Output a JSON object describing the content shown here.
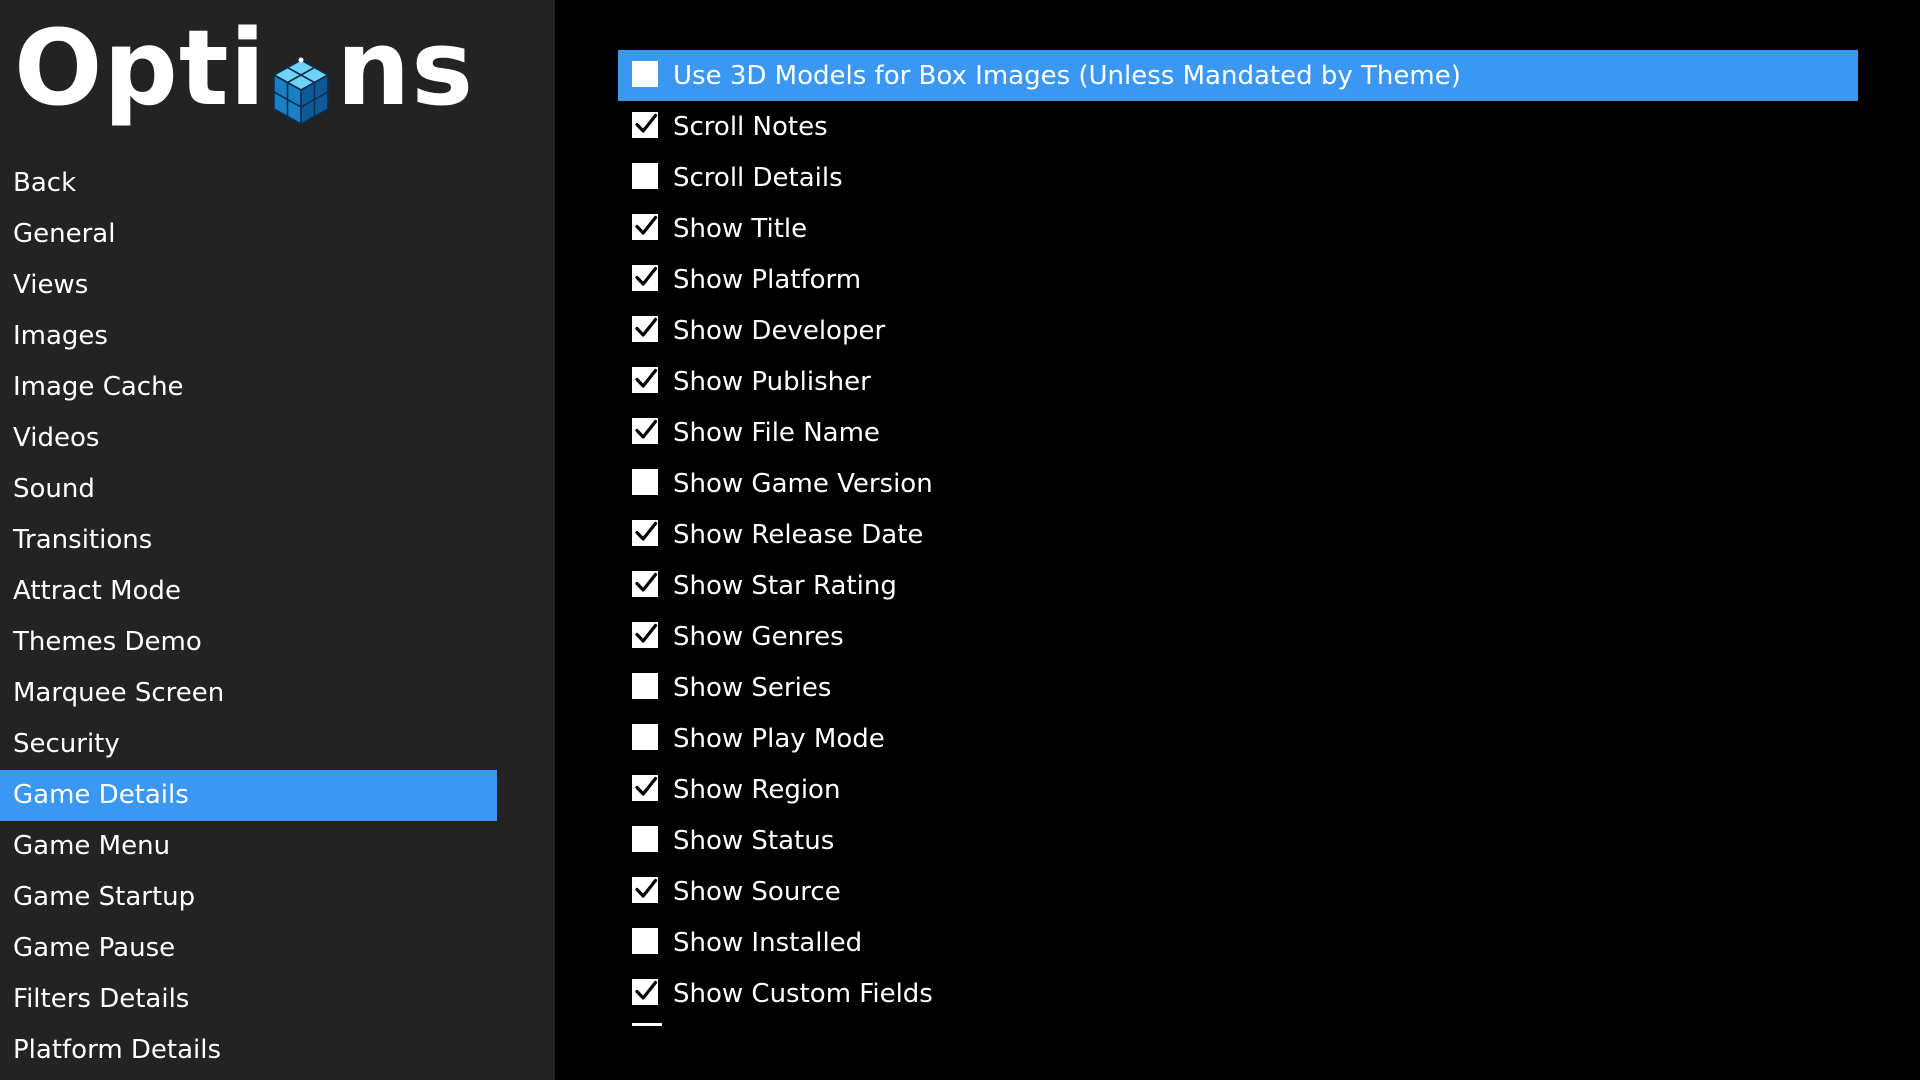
{
  "logo": {
    "text_before": "Opti",
    "text_after": "ns",
    "icon": "cube-icon"
  },
  "menu": {
    "items": [
      {
        "label": "Back",
        "selected": false
      },
      {
        "label": "General",
        "selected": false
      },
      {
        "label": "Views",
        "selected": false
      },
      {
        "label": "Images",
        "selected": false
      },
      {
        "label": "Image Cache",
        "selected": false
      },
      {
        "label": "Videos",
        "selected": false
      },
      {
        "label": "Sound",
        "selected": false
      },
      {
        "label": "Transitions",
        "selected": false
      },
      {
        "label": "Attract Mode",
        "selected": false
      },
      {
        "label": "Themes Demo",
        "selected": false
      },
      {
        "label": "Marquee Screen",
        "selected": false
      },
      {
        "label": "Security",
        "selected": false
      },
      {
        "label": "Game Details",
        "selected": true
      },
      {
        "label": "Game Menu",
        "selected": false
      },
      {
        "label": "Game Startup",
        "selected": false
      },
      {
        "label": "Game Pause",
        "selected": false
      },
      {
        "label": "Filters Details",
        "selected": false
      },
      {
        "label": "Platform Details",
        "selected": false
      }
    ]
  },
  "options": {
    "items": [
      {
        "label": "Use 3D Models for Box Images (Unless Mandated by Theme)",
        "checked": false,
        "selected": true
      },
      {
        "label": "Scroll Notes",
        "checked": true,
        "selected": false
      },
      {
        "label": "Scroll Details",
        "checked": false,
        "selected": false
      },
      {
        "label": "Show Title",
        "checked": true,
        "selected": false
      },
      {
        "label": "Show Platform",
        "checked": true,
        "selected": false
      },
      {
        "label": "Show Developer",
        "checked": true,
        "selected": false
      },
      {
        "label": "Show Publisher",
        "checked": true,
        "selected": false
      },
      {
        "label": "Show File Name",
        "checked": true,
        "selected": false
      },
      {
        "label": "Show Game Version",
        "checked": false,
        "selected": false
      },
      {
        "label": "Show Release Date",
        "checked": true,
        "selected": false
      },
      {
        "label": "Show Star Rating",
        "checked": true,
        "selected": false
      },
      {
        "label": "Show Genres",
        "checked": true,
        "selected": false
      },
      {
        "label": "Show Series",
        "checked": false,
        "selected": false
      },
      {
        "label": "Show Play Mode",
        "checked": false,
        "selected": false
      },
      {
        "label": "Show Region",
        "checked": true,
        "selected": false
      },
      {
        "label": "Show Status",
        "checked": false,
        "selected": false
      },
      {
        "label": "Show Source",
        "checked": true,
        "selected": false
      },
      {
        "label": "Show Installed",
        "checked": false,
        "selected": false
      },
      {
        "label": "Show Custom Fields",
        "checked": true,
        "selected": false
      }
    ]
  },
  "colors": {
    "accent": "#3a97f2",
    "sidebar_bg": "#232323",
    "content_bg": "#000000",
    "text": "#ffffff"
  }
}
